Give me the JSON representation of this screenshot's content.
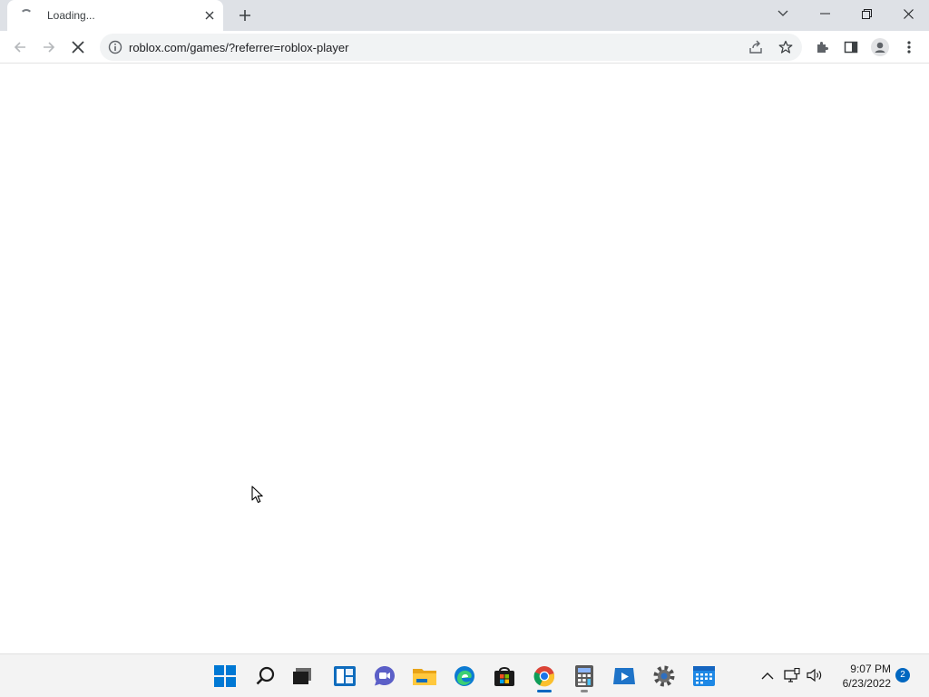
{
  "browser": {
    "tab": {
      "title": "Loading..."
    },
    "address_bar": {
      "url": "roblox.com/games/?referrer=roblox-player"
    }
  },
  "taskbar": {
    "apps": [
      {
        "name": "start",
        "icon": "windows-start-icon"
      },
      {
        "name": "search",
        "icon": "search-icon"
      },
      {
        "name": "task-view",
        "icon": "task-view-icon"
      },
      {
        "name": "widgets",
        "icon": "widgets-icon"
      },
      {
        "name": "chat",
        "icon": "chat-icon"
      },
      {
        "name": "file-explorer",
        "icon": "folder-icon"
      },
      {
        "name": "edge",
        "icon": "edge-icon"
      },
      {
        "name": "store",
        "icon": "store-icon"
      },
      {
        "name": "chrome",
        "icon": "chrome-icon",
        "running": true,
        "active": true
      },
      {
        "name": "calculator",
        "icon": "calculator-icon",
        "running": true
      },
      {
        "name": "media-player",
        "icon": "media-player-icon"
      },
      {
        "name": "settings",
        "icon": "settings-icon"
      },
      {
        "name": "calendar",
        "icon": "calendar-icon"
      }
    ],
    "clock": {
      "time": "9:07 PM",
      "date": "6/23/2022"
    },
    "notifications": {
      "count": "2"
    }
  },
  "colors": {
    "tabstrip": "#dee1e6",
    "omnibox": "#f1f3f4",
    "taskbar": "#f3f3f3",
    "accent": "#0067c0"
  }
}
